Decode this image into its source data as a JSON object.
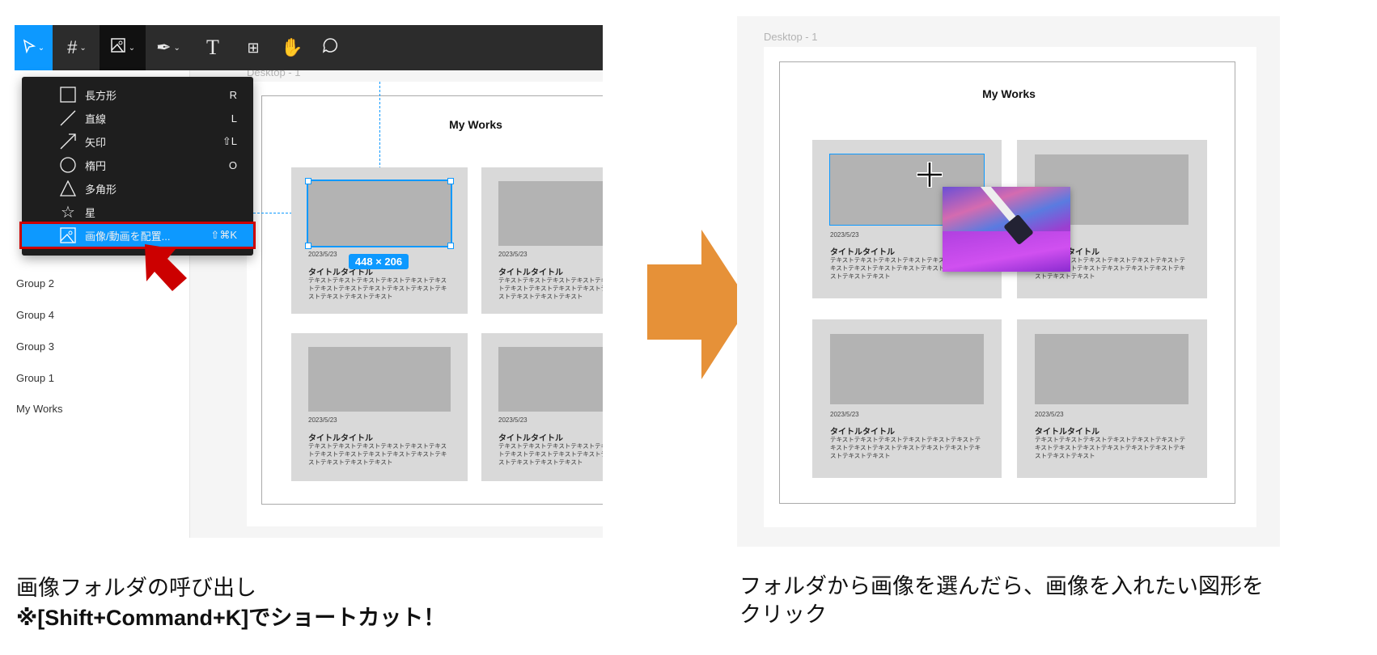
{
  "left_panel": {
    "toolbar": {
      "tools": [
        {
          "name": "move",
          "icon": "cursor-arrow-icon"
        },
        {
          "name": "frame",
          "icon": "hash-frame-icon"
        },
        {
          "name": "image",
          "icon": "image-icon"
        },
        {
          "name": "pen",
          "icon": "pen-icon"
        },
        {
          "name": "text",
          "icon": "text-icon",
          "label": "T"
        },
        {
          "name": "resources",
          "icon": "components-icon"
        },
        {
          "name": "hand",
          "icon": "hand-icon"
        },
        {
          "name": "comment",
          "icon": "comment-icon"
        }
      ],
      "active_color": "#0d99ff"
    },
    "menu": {
      "items": [
        {
          "label": "長方形",
          "shortcut": "R",
          "icon": "square-icon"
        },
        {
          "label": "直線",
          "shortcut": "L",
          "icon": "line-icon"
        },
        {
          "label": "矢印",
          "shortcut": "⇧L",
          "icon": "arrow-icon"
        },
        {
          "label": "楕円",
          "shortcut": "O",
          "icon": "ellipse-icon"
        },
        {
          "label": "多角形",
          "shortcut": "",
          "icon": "triangle-icon"
        },
        {
          "label": "星",
          "shortcut": "",
          "icon": "star-icon"
        },
        {
          "label": "画像/動画を配置...",
          "shortcut": "⇧⌘K",
          "icon": "image-icon",
          "selected": true
        }
      ]
    },
    "layers": [
      "Group 2",
      "Group 4",
      "Group 3",
      "Group 1",
      "My Works"
    ],
    "frame_label": "Desktop - 1",
    "frame_title": "My Works",
    "selection_size": "448 × 206",
    "highlight_color": "#cc0000"
  },
  "card": {
    "date": "2023/5/23",
    "title": "タイトルタイトル",
    "body": "テキストテキストテキストテキストテキストテキストテキストテキストテキストテキストテキストテキストテキストテキストテキスト"
  },
  "right_panel": {
    "frame_label": "Desktop - 1",
    "frame_title": "My Works"
  },
  "arrow_color": "#e69138",
  "captions": {
    "left_line1": "画像フォルダの呼び出し",
    "left_line2": "※[Shift+Command+K]でショートカット！",
    "right_line1": "フォルダから画像を選んだら、画像を入れたい図形を",
    "right_line2": "クリック"
  }
}
